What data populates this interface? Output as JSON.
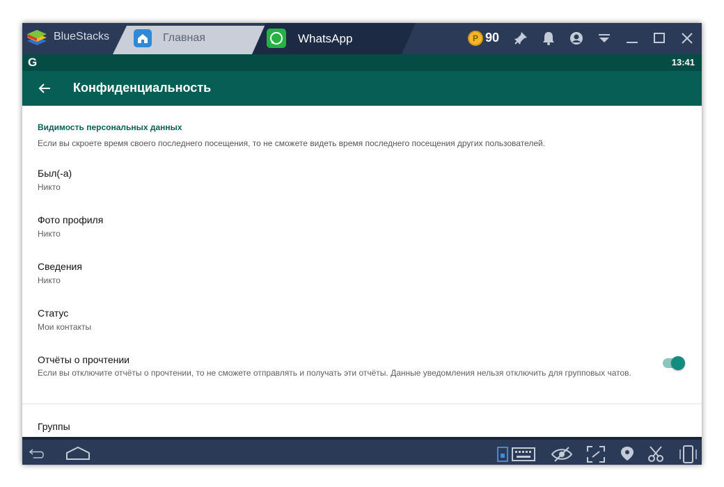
{
  "titlebar": {
    "app_name": "BlueStacks",
    "tabs": [
      {
        "label": "Главная",
        "icon": "home-icon"
      },
      {
        "label": "WhatsApp",
        "icon": "whatsapp-icon"
      }
    ],
    "coin_symbol": "P",
    "coins": "90",
    "icons": [
      "pin-icon",
      "bell-icon",
      "account-icon",
      "dropdown-icon",
      "minimize-icon",
      "maximize-icon",
      "close-icon"
    ]
  },
  "statusbar": {
    "left_glyph": "G",
    "time": "13:41"
  },
  "appbar": {
    "title": "Конфиденциальность"
  },
  "content": {
    "section_header": "Видимость персональных данных",
    "section_desc": "Если вы скроете время своего последнего посещения, то не сможете видеть время последнего посещения других пользователей.",
    "items": [
      {
        "title": "Был(-а)",
        "value": "Никто"
      },
      {
        "title": "Фото профиля",
        "value": "Никто"
      },
      {
        "title": "Сведения",
        "value": "Никто"
      },
      {
        "title": "Статус",
        "value": "Мои контакты"
      }
    ],
    "read_receipts": {
      "title": "Отчёты о прочтении",
      "desc": "Если вы отключите отчёты о прочтении, то не сможете отправлять и получать эти отчёты. Данные уведомления нельзя отключить для групповых чатов.",
      "enabled": true
    },
    "groups": {
      "title": "Группы"
    }
  },
  "bottombar": {
    "icons": [
      "back-icon",
      "home-outline-icon",
      "keyboard-icon",
      "eye-slash-icon",
      "fullscreen-icon",
      "location-icon",
      "scissors-icon",
      "phone-rotate-icon"
    ]
  },
  "colors": {
    "titlebar": "#2b3a57",
    "statusbar": "#054d44",
    "appbar": "#075e54",
    "accent": "#128c7e"
  }
}
